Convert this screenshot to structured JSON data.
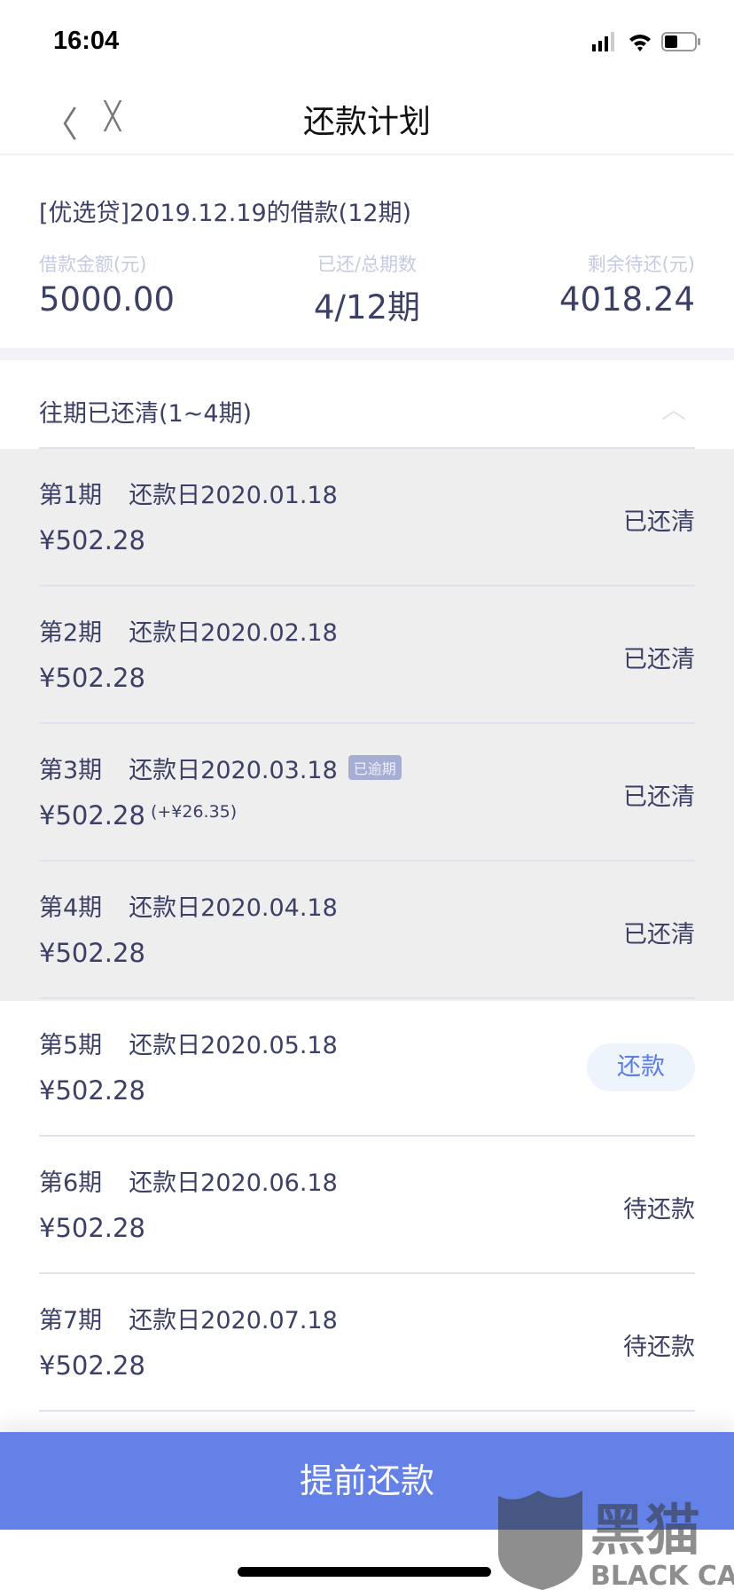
{
  "status_bar": {
    "time": "16:04"
  },
  "nav": {
    "title": "还款计划",
    "back": "〈",
    "close": "╳"
  },
  "loan": {
    "title": "[优选贷]2019.12.19的借款(12期)",
    "summary": [
      {
        "label": "借款金额(元)",
        "value": "5000.00"
      },
      {
        "label": "已还/总期数",
        "value": "4/12期"
      },
      {
        "label": "剩余待还(元)",
        "value": "4018.24"
      }
    ]
  },
  "section": {
    "title": "往期已还清(1~4期)",
    "chevron": "︿"
  },
  "installments": [
    {
      "period": "第1期",
      "date": "还款日2020.01.18",
      "amount": "¥502.28",
      "status": "已还清"
    },
    {
      "period": "第2期",
      "date": "还款日2020.02.18",
      "amount": "¥502.28",
      "status": "已还清"
    },
    {
      "period": "第3期",
      "date": "还款日2020.03.18",
      "tag": "已逾期",
      "amount": "¥502.28",
      "penalty": "(+¥26.35)",
      "status": "已还清"
    },
    {
      "period": "第4期",
      "date": "还款日2020.04.18",
      "amount": "¥502.28",
      "status": "已还清"
    },
    {
      "period": "第5期",
      "date": "还款日2020.05.18",
      "amount": "¥502.28",
      "action": "还款"
    },
    {
      "period": "第6期",
      "date": "还款日2020.06.18",
      "amount": "¥502.28",
      "status": "待还款"
    },
    {
      "period": "第7期",
      "date": "还款日2020.07.18",
      "amount": "¥502.28",
      "status": "待还款"
    }
  ],
  "footer": {
    "button": "提前还款"
  },
  "watermark": {
    "text": "黑猫",
    "sub": "BLACK CAT"
  },
  "colors": {
    "primary": "#6381e6",
    "text": "#3c4066",
    "paid_bg": "#eeeeef"
  }
}
